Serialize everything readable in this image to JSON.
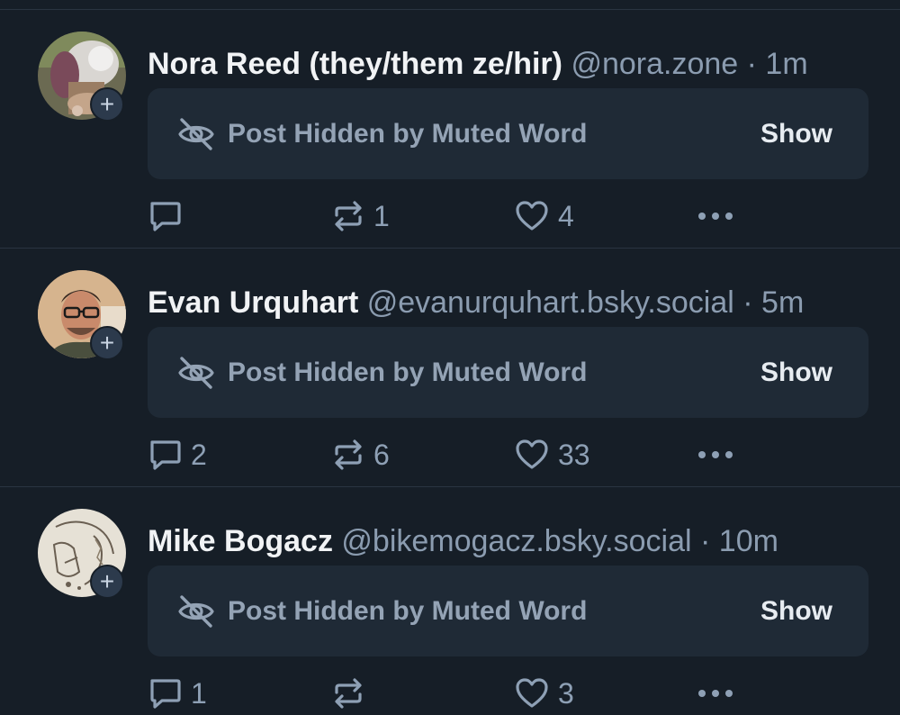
{
  "posts": [
    {
      "author_name": "Nora Reed (they/them ze/hir)",
      "handle": "@nora.zone",
      "separator": "·",
      "time": "1m",
      "hidden_label": "Post Hidden by Muted Word",
      "show_label": "Show",
      "replies": "",
      "reposts": "1",
      "likes": "4"
    },
    {
      "author_name": "Evan Urquhart",
      "handle": "@evanurquhart.bsky.social",
      "separator": "·",
      "time": "5m",
      "hidden_label": "Post Hidden by Muted Word",
      "show_label": "Show",
      "replies": "2",
      "reposts": "6",
      "likes": "33"
    },
    {
      "author_name": "Mike Bogacz",
      "handle": "@bikemogacz.bsky.social",
      "separator": "·",
      "time": "10m",
      "hidden_label": "Post Hidden by Muted Word",
      "show_label": "Show",
      "replies": "1",
      "reposts": "",
      "likes": "3"
    }
  ],
  "icons": {
    "follow": "plus-icon",
    "hidden": "eye-off-icon",
    "reply": "reply-icon",
    "repost": "repost-icon",
    "like": "heart-icon",
    "more": "more-icon"
  },
  "colors": {
    "background": "#161e27",
    "card": "#1f2a36",
    "name": "#f1f3f5",
    "muted": "#8b9cb0",
    "divider": "#2a3441"
  }
}
